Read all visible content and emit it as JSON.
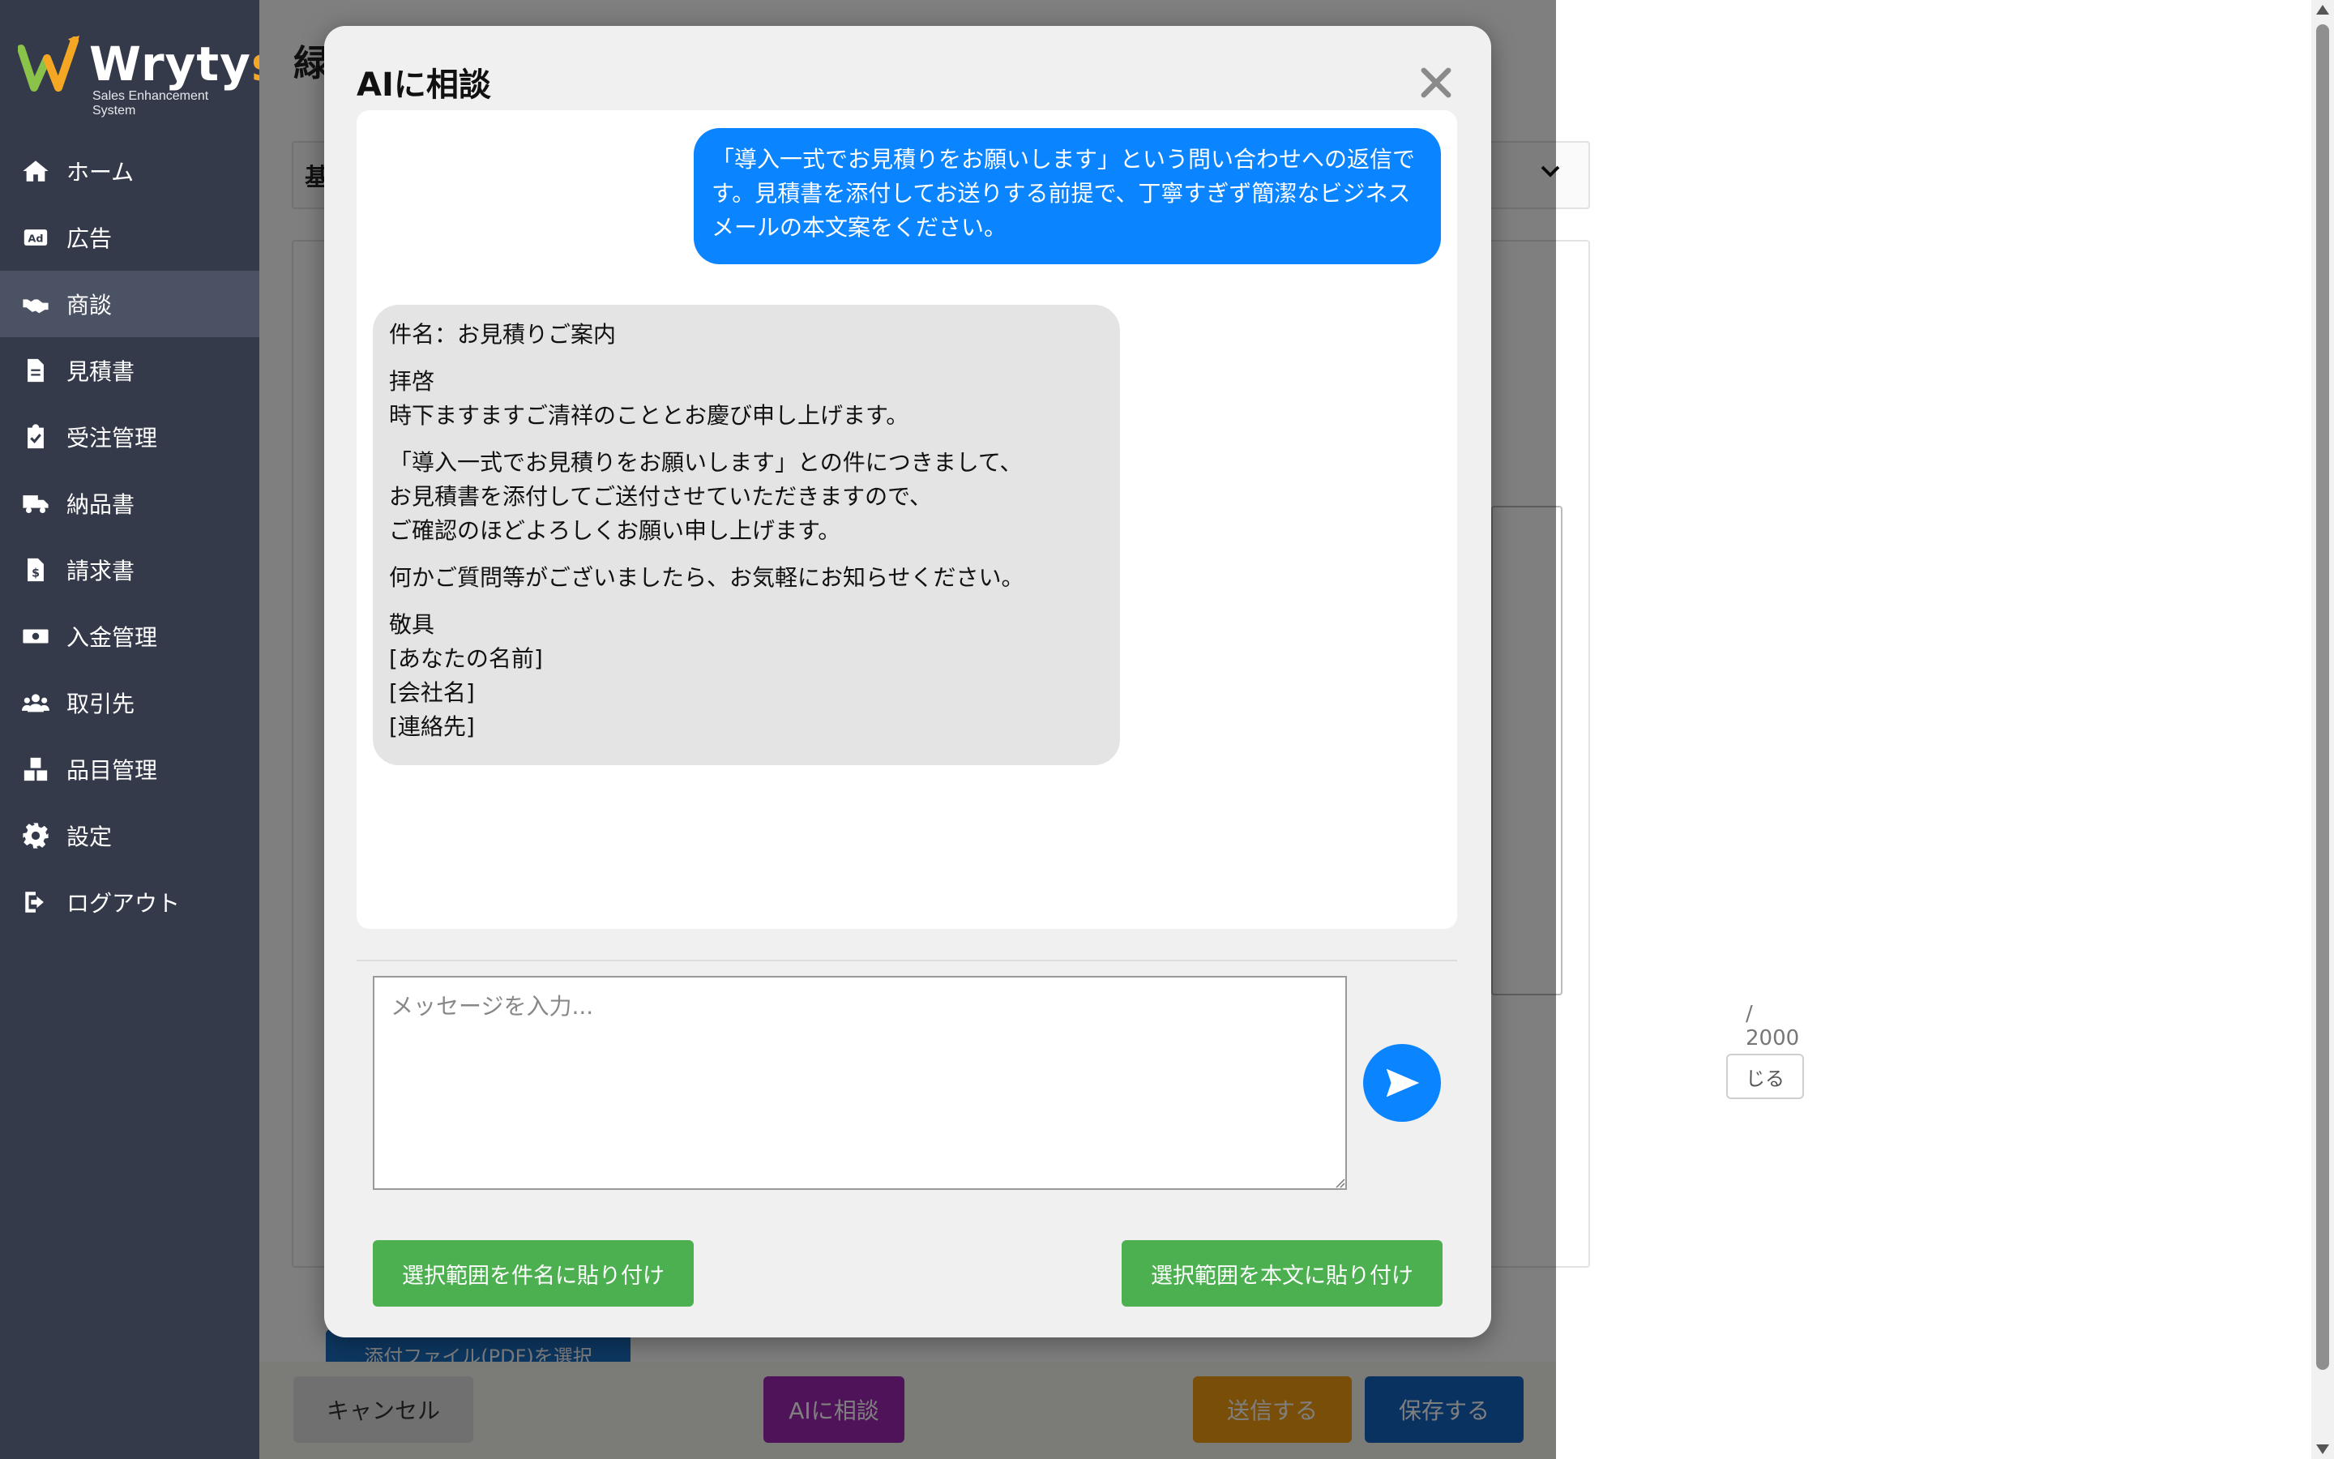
{
  "app": {
    "logo_text_main": "Wryty",
    "logo_text_accent": "s",
    "logo_subtitle": "Sales Enhancement System"
  },
  "sidebar": {
    "items": [
      {
        "label": "ホーム",
        "icon": "home-icon"
      },
      {
        "label": "広告",
        "icon": "ad-icon"
      },
      {
        "label": "商談",
        "icon": "handshake-icon",
        "active": true
      },
      {
        "label": "見積書",
        "icon": "document-icon"
      },
      {
        "label": "受注管理",
        "icon": "clipboard-check-icon"
      },
      {
        "label": "納品書",
        "icon": "truck-icon"
      },
      {
        "label": "請求書",
        "icon": "invoice-icon"
      },
      {
        "label": "入金管理",
        "icon": "money-icon"
      },
      {
        "label": "取引先",
        "icon": "users-icon"
      },
      {
        "label": "品目管理",
        "icon": "boxes-icon"
      },
      {
        "label": "設定",
        "icon": "gear-icon"
      },
      {
        "label": "ログアウト",
        "icon": "logout-icon"
      }
    ]
  },
  "background_page": {
    "title_partial": "緑",
    "section_partial": "基",
    "counter_partial": "/ 2000",
    "close_partial": "じる",
    "attach_partial": "添付ファイル(PDF)を選択",
    "buttons": {
      "cancel": "キャンセル",
      "ai_consult": "AIに相談",
      "send": "送信する",
      "save": "保存する"
    }
  },
  "modal": {
    "title": "AIに相談",
    "messages": {
      "user": "「導入一式でお見積りをお願いします」という問い合わせへの返信です。見積書を添付してお送りする前提で、丁寧すぎず簡潔なビジネスメールの本文案をください。",
      "ai": {
        "p1": "件名：お見積りご案内",
        "p2": "拝啓\n時下ますますご清祥のこととお慶び申し上げます。",
        "p3": "「導入一式でお見積りをお願いします」との件につきまして、\nお見積書を添付してご送付させていただきますので、\nご確認のほどよろしくお願い申し上げます。",
        "p4": "何かご質問等がございましたら、お気軽にお知らせください。",
        "p5": "敬具\n[あなたの名前]\n[会社名]\n[連絡先]"
      }
    },
    "input": {
      "placeholder": "メッセージを入力...",
      "value": ""
    },
    "buttons": {
      "paste_subject": "選択範囲を件名に貼り付け",
      "paste_body": "選択範囲を本文に貼り付け"
    }
  },
  "colors": {
    "sidebar_bg": "#343a4a",
    "accent_blue": "#0a84ff",
    "green": "#4caf50",
    "logo_accent": "#f5a623"
  }
}
